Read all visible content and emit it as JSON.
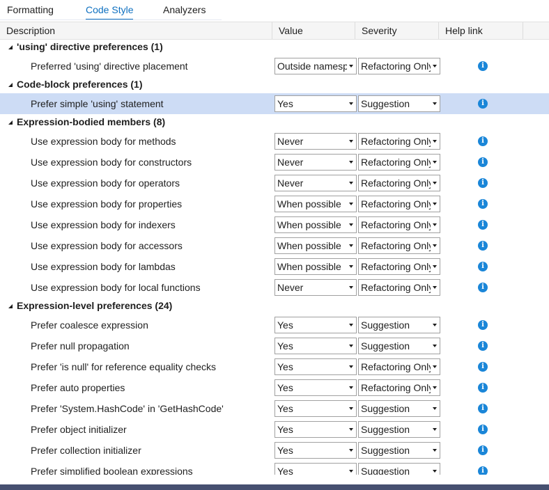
{
  "tabs": [
    "Formatting",
    "Code Style",
    "Analyzers"
  ],
  "active_tab": "Code Style",
  "columns": [
    "Description",
    "Value",
    "Severity",
    "Help link"
  ],
  "groups": [
    {
      "title": "'using' directive preferences (1)",
      "items": [
        {
          "desc": "Preferred 'using' directive placement",
          "value": "Outside namespace",
          "severity": "Refactoring Only"
        }
      ]
    },
    {
      "title": "Code-block preferences (1)",
      "items": [
        {
          "desc": "Prefer simple 'using' statement",
          "value": "Yes",
          "severity": "Suggestion",
          "selected": true
        }
      ]
    },
    {
      "title": "Expression-bodied members (8)",
      "items": [
        {
          "desc": "Use expression body for methods",
          "value": "Never",
          "severity": "Refactoring Only"
        },
        {
          "desc": "Use expression body for constructors",
          "value": "Never",
          "severity": "Refactoring Only"
        },
        {
          "desc": "Use expression body for operators",
          "value": "Never",
          "severity": "Refactoring Only"
        },
        {
          "desc": "Use expression body for properties",
          "value": "When possible",
          "severity": "Refactoring Only"
        },
        {
          "desc": "Use expression body for indexers",
          "value": "When possible",
          "severity": "Refactoring Only"
        },
        {
          "desc": "Use expression body for accessors",
          "value": "When possible",
          "severity": "Refactoring Only"
        },
        {
          "desc": "Use expression body for lambdas",
          "value": "When possible",
          "severity": "Refactoring Only"
        },
        {
          "desc": "Use expression body for local functions",
          "value": "Never",
          "severity": "Refactoring Only"
        }
      ]
    },
    {
      "title": "Expression-level preferences (24)",
      "items": [
        {
          "desc": "Prefer coalesce expression",
          "value": "Yes",
          "severity": "Suggestion"
        },
        {
          "desc": "Prefer null propagation",
          "value": "Yes",
          "severity": "Suggestion"
        },
        {
          "desc": "Prefer 'is null' for reference equality checks",
          "value": "Yes",
          "severity": "Refactoring Only"
        },
        {
          "desc": "Prefer auto properties",
          "value": "Yes",
          "severity": "Refactoring Only"
        },
        {
          "desc": "Prefer 'System.HashCode' in 'GetHashCode'",
          "value": "Yes",
          "severity": "Suggestion"
        },
        {
          "desc": "Prefer object initializer",
          "value": "Yes",
          "severity": "Suggestion"
        },
        {
          "desc": "Prefer collection initializer",
          "value": "Yes",
          "severity": "Suggestion"
        },
        {
          "desc": "Prefer simplified boolean expressions",
          "value": "Yes",
          "severity": "Suggestion"
        }
      ]
    }
  ],
  "help_icon": "info-icon",
  "colors": {
    "accent": "#0e70c0",
    "selected_row": "#cddcf5",
    "info": "#1a86d8",
    "bottom_bar": "#465070"
  }
}
